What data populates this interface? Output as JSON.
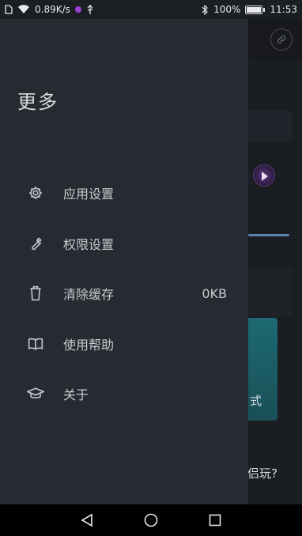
{
  "status_bar": {
    "net_speed": "0.89K/s",
    "battery_percent": "100%",
    "time": "11:53"
  },
  "drawer": {
    "title": "更多",
    "items": [
      {
        "label": "应用设置",
        "icon": "gear-icon"
      },
      {
        "label": "权限设置",
        "icon": "wrench-icon"
      },
      {
        "label": "清除缓存",
        "icon": "trash-icon",
        "value": "0KB"
      },
      {
        "label": "使用帮助",
        "icon": "book-icon"
      },
      {
        "label": "关于",
        "icon": "graduation-cap-icon"
      }
    ]
  },
  "background": {
    "teal_card_text": "式",
    "partial_text": "侣玩?"
  }
}
